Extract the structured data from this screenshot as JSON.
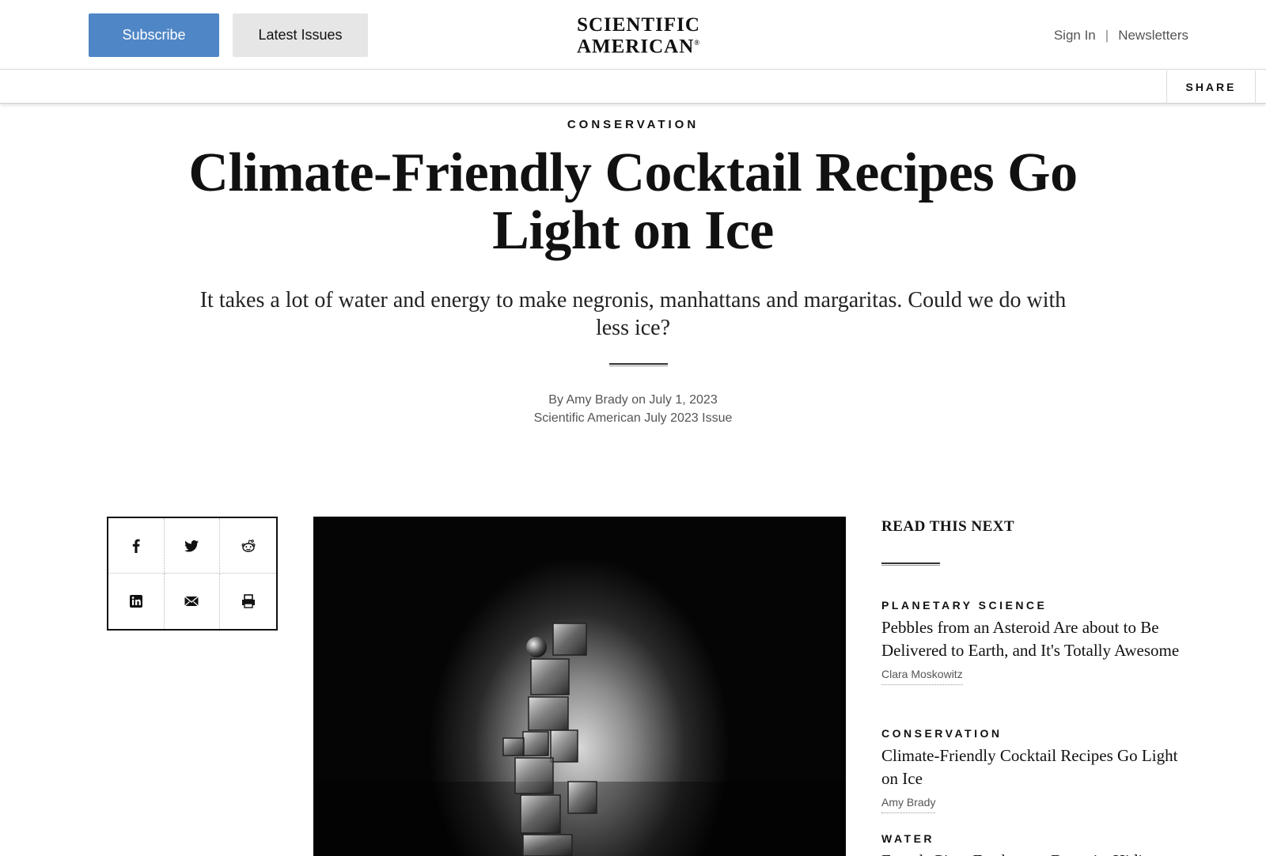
{
  "header": {
    "subscribe_label": "Subscribe",
    "latest_issues_label": "Latest Issues",
    "logo_line1": "SCIENTIFIC",
    "logo_line2": "AMERICAN",
    "logo_mark": "®",
    "sign_in_label": "Sign In",
    "separator": "|",
    "newsletters_label": "Newsletters",
    "accent_color": "#4f86c6"
  },
  "sharebar": {
    "share_label": "SHARE"
  },
  "article": {
    "kicker": "CONSERVATION",
    "title": "Climate-Friendly Cocktail Recipes Go Light on Ice",
    "dek": "It takes a lot of water and energy to make negronis, manhattans and margaritas. Could we do with less ice?",
    "byline": "By Amy Brady on July 1, 2023",
    "issue": "Scientific American July 2023 Issue"
  },
  "share_icons": [
    "facebook-icon",
    "twitter-icon",
    "reddit-icon",
    "linkedin-icon",
    "email-icon",
    "print-icon"
  ],
  "read_next": {
    "heading": "READ THIS NEXT",
    "items": [
      {
        "kicker": "PLANETARY SCIENCE",
        "title": "Pebbles from an Asteroid Are about to Be Delivered to Earth, and It's Totally Awesome",
        "author": "Clara Moskowitz"
      },
      {
        "kicker": "CONSERVATION",
        "title": "Climate-Friendly Cocktail Recipes Go Light on Ice",
        "author": "Amy Brady"
      },
      {
        "kicker": "WATER",
        "title": "French Giant Freshwater Deposits Hiding",
        "author": ""
      }
    ]
  }
}
